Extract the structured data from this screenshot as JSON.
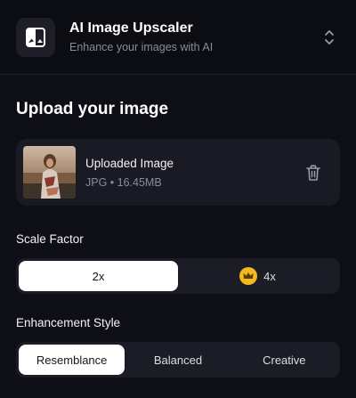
{
  "header": {
    "title": "AI Image Upscaler",
    "subtitle": "Enhance your images with AI",
    "icon": "image-compare-icon"
  },
  "upload": {
    "section_title": "Upload your image",
    "file_name": "Uploaded Image",
    "file_meta": "JPG • 16.45MB"
  },
  "scale": {
    "label": "Scale Factor",
    "options": [
      "2x",
      "4x"
    ],
    "selected": "2x",
    "premium_option": "4x"
  },
  "style": {
    "label": "Enhancement Style",
    "options": [
      "Resemblance",
      "Balanced",
      "Creative"
    ],
    "selected": "Resemblance"
  },
  "colors": {
    "background": "#0e0e16",
    "card": "#1a1a24",
    "active_segment": "#ffffff",
    "crown": "#f2b920"
  }
}
